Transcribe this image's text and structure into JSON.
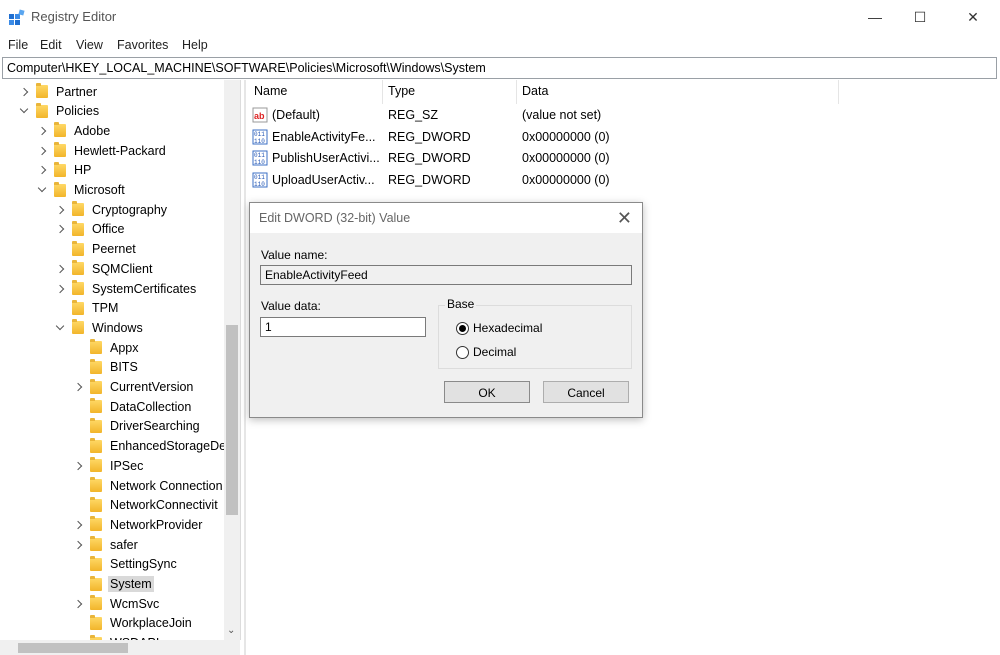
{
  "window": {
    "title": "Registry Editor",
    "icon": "registry-editor-icon",
    "controls": {
      "minimize": "—",
      "maximize": "☐",
      "close": "✕"
    }
  },
  "menu": [
    "File",
    "Edit",
    "View",
    "Favorites",
    "Help"
  ],
  "address": "Computer\\HKEY_LOCAL_MACHINE\\SOFTWARE\\Policies\\Microsoft\\Windows\\System",
  "tree": [
    {
      "label": "Partner",
      "expander": "right"
    },
    {
      "label": "Policies",
      "expander": "down"
    },
    {
      "label": "Adobe",
      "expander": "right"
    },
    {
      "label": "Hewlett-Packard",
      "expander": "right"
    },
    {
      "label": "HP",
      "expander": "right"
    },
    {
      "label": "Microsoft",
      "expander": "down"
    },
    {
      "label": "Cryptography",
      "expander": "right"
    },
    {
      "label": "Office",
      "expander": "right"
    },
    {
      "label": "Peernet",
      "expander": "none"
    },
    {
      "label": "SQMClient",
      "expander": "right"
    },
    {
      "label": "SystemCertificates",
      "expander": "right"
    },
    {
      "label": "TPM",
      "expander": "none"
    },
    {
      "label": "Windows",
      "expander": "down"
    },
    {
      "label": "Appx",
      "expander": "none"
    },
    {
      "label": "BITS",
      "expander": "none"
    },
    {
      "label": "CurrentVersion",
      "expander": "right"
    },
    {
      "label": "DataCollection",
      "expander": "none"
    },
    {
      "label": "DriverSearching",
      "expander": "none"
    },
    {
      "label": "EnhancedStorageDe",
      "expander": "none"
    },
    {
      "label": "IPSec",
      "expander": "right"
    },
    {
      "label": "Network Connection",
      "expander": "none"
    },
    {
      "label": "NetworkConnectivit",
      "expander": "none"
    },
    {
      "label": "NetworkProvider",
      "expander": "right"
    },
    {
      "label": "safer",
      "expander": "right"
    },
    {
      "label": "SettingSync",
      "expander": "none"
    },
    {
      "label": "System",
      "expander": "none",
      "selected": true
    },
    {
      "label": "WcmSvc",
      "expander": "right"
    },
    {
      "label": "WorkplaceJoin",
      "expander": "none"
    },
    {
      "label": "WSDAPI",
      "expander": "none"
    }
  ],
  "columns": {
    "name": "Name",
    "type": "Type",
    "data": "Data"
  },
  "values": [
    {
      "name": "(Default)",
      "type": "REG_SZ",
      "data": "(value not set)",
      "icon": "string-value-icon"
    },
    {
      "name": "EnableActivityFe...",
      "type": "REG_DWORD",
      "data": "0x00000000 (0)",
      "icon": "binary-value-icon"
    },
    {
      "name": "PublishUserActivi...",
      "type": "REG_DWORD",
      "data": "0x00000000 (0)",
      "icon": "binary-value-icon"
    },
    {
      "name": "UploadUserActiv...",
      "type": "REG_DWORD",
      "data": "0x00000000 (0)",
      "icon": "binary-value-icon"
    }
  ],
  "dialog": {
    "title": "Edit DWORD (32-bit) Value",
    "value_name_label": "Value name:",
    "value_name": "EnableActivityFeed",
    "value_data_label": "Value data:",
    "value_data": "1",
    "base_label": "Base",
    "hex_label": "Hexadecimal",
    "dec_label": "Decimal",
    "ok": "OK",
    "cancel": "Cancel"
  }
}
